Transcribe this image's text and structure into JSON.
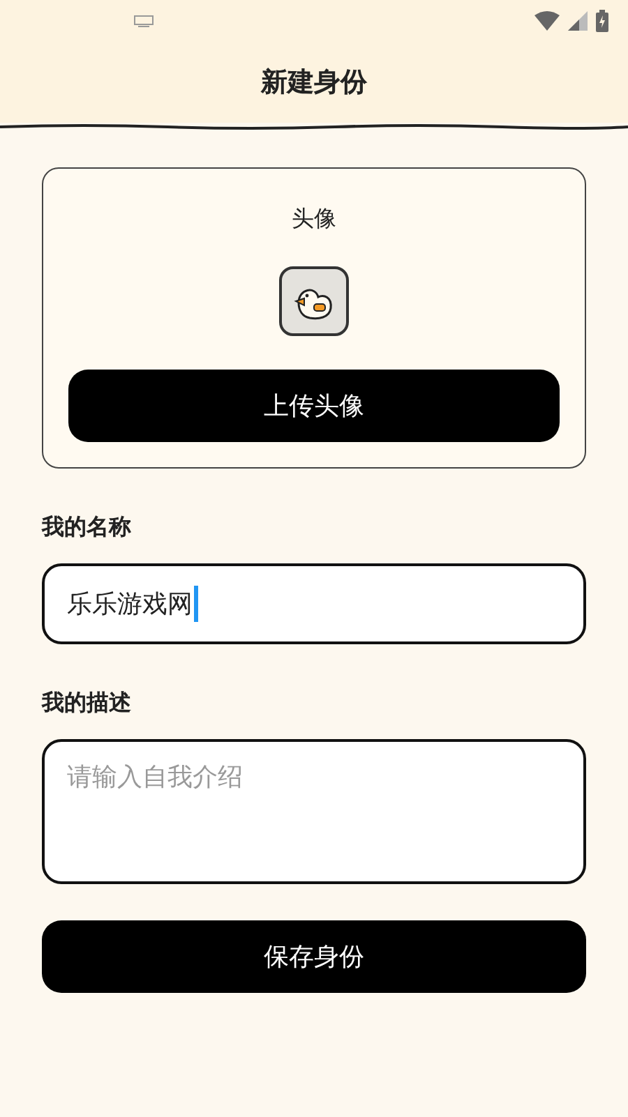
{
  "header": {
    "title": "新建身份"
  },
  "avatar_card": {
    "label": "头像",
    "upload_button": "上传头像"
  },
  "name_field": {
    "label": "我的名称",
    "value": "乐乐游戏网",
    "focused": true
  },
  "description_field": {
    "label": "我的描述",
    "placeholder": "请输入自我介绍"
  },
  "save_button": "保存身份"
}
